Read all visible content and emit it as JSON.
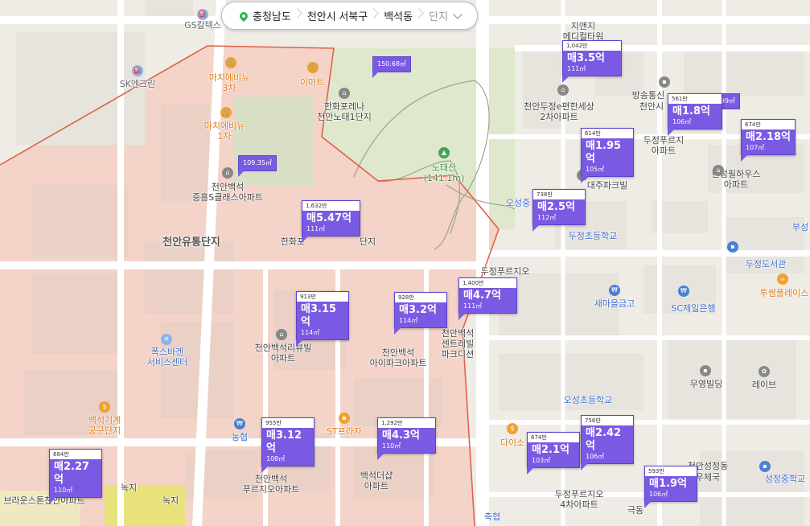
{
  "breadcrumb": {
    "province": "충청남도",
    "city": "천안시 서북구",
    "dong": "백석동",
    "complex_placeholder": "단지"
  },
  "colors": {
    "marker": "#7b5ae3",
    "district": "#f4d3c8",
    "park": "#dce6c8",
    "boundary": "#e0624a"
  },
  "map_labels": {
    "gs": "GS칼텍스",
    "sk": "SK엔크린",
    "mart1": "마치에비뉴\n3차",
    "emart": "이마트",
    "mart2": "마치에비뉴\n1차",
    "hanwha": "한화포레나\n천안노태1단지",
    "notaesan": "노태산\n(141.1m)",
    "jungheung": "천안백석\n중흥S클래스아파트",
    "yutong": "천안유통단지",
    "hanwha2": "한화포",
    "hanwha2b": "단지",
    "jiaenji": "지앤지\n메디컬타워",
    "dujeong_e": "천안두정e편한세상\n2차아파트",
    "broadcast": "방송통신",
    "cheonansi": "천안시",
    "dujeong_pu": "두정푸르지\n아파트",
    "hansung": "한성필하우스\n아파트",
    "daeju": "대주파크빌",
    "osung_jung": "오성중",
    "dujeong_elem": "두정초등학교",
    "dujeong_lib": "두정도서관",
    "dujeong_pu2": "두정푸르지오\n아파트",
    "saemaeul": "새마을금고",
    "sc": "SC제일은행",
    "twosome": "투썸플레이스",
    "foxbagen": "폭스바겐\n서비스센터",
    "baekseok_rv": "천안백석리뷰빌\n아파트",
    "baekseok_ai": "천안백석\n아이파크아파트",
    "baekseok_ct": "천안백석\n센트레빌\n파크디션",
    "muyoung": "무영빌딩",
    "lebib": "레이브",
    "osung_elem": "오성초등학교",
    "baekseok_gigae": "백석기계\n공구단지",
    "nonghyup": "농협",
    "st": "ST프라자",
    "daiso": "다이소",
    "baekseok_pu": "천안백석\n푸르지오아파트",
    "baekseok_dasap": "백석더샵\n아파트",
    "dujeong_pu4": "두정푸르지오\n4차아파트",
    "cheonanseong": "천안성정동",
    "sports": "우체국",
    "seongjeong_mid": "성정중학교",
    "brown": "브라운스톤천안아파트",
    "nokji1": "녹지",
    "nokji2": "녹지",
    "chukhyup": "축협",
    "geukdong": "극동",
    "busung": "부성"
  },
  "markers": [
    {
      "count": "1,042만",
      "price": "매3.5억",
      "area": "111㎡"
    },
    {
      "count": "561만",
      "price": "매1.8억",
      "area": "106㎡"
    },
    {
      "count": "674만",
      "price": "매2.18억",
      "area": "107㎡"
    },
    {
      "count": "614만",
      "price": "매1.95억",
      "area": "105㎡"
    },
    {
      "count": "738만",
      "price": "매2.5억",
      "area": "112㎡"
    },
    {
      "count": "1,632만",
      "price": "매5.47억",
      "area": "111㎡"
    },
    {
      "count": "1,400만",
      "price": "매4.7억",
      "area": "111㎡"
    },
    {
      "count": "913만",
      "price": "매3.15억",
      "area": "114㎡"
    },
    {
      "count": "928만",
      "price": "매3.2억",
      "area": "114㎡"
    },
    {
      "count": "955만",
      "price": "매3.12억",
      "area": "108㎡"
    },
    {
      "count": "1,292만",
      "price": "매4.3억",
      "area": "110㎡"
    },
    {
      "count": "674만",
      "price": "매2.1억",
      "area": "103㎡"
    },
    {
      "count": "756만",
      "price": "매2.42억",
      "area": "106㎡"
    },
    {
      "count": "593만",
      "price": "매1.9억",
      "area": "106㎡"
    },
    {
      "count": "684만",
      "price": "매2.27억",
      "area": "110㎡"
    }
  ],
  "small_markers": [
    {
      "area": "150.68㎡"
    },
    {
      "area": "109.35㎡"
    },
    {
      "area": "54.99㎡"
    }
  ]
}
